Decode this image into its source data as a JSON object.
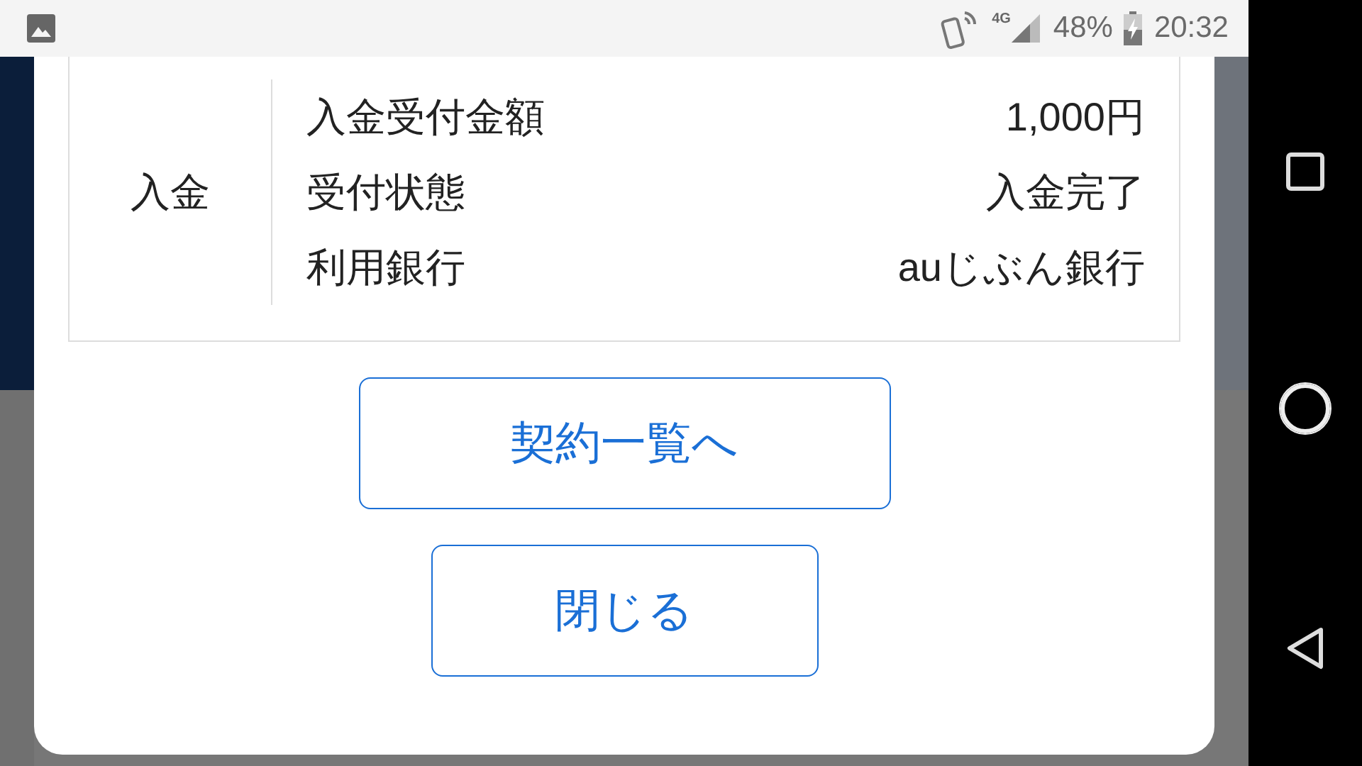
{
  "status_bar": {
    "network": "4G",
    "battery": "48%",
    "time": "20:32"
  },
  "details": {
    "section": "入金",
    "rows": [
      {
        "label": "入金受付金額",
        "value": "1,000円"
      },
      {
        "label": "受付状態",
        "value": "入金完了"
      },
      {
        "label": "利用銀行",
        "value": "auじぶん銀行"
      }
    ]
  },
  "buttons": [
    {
      "label": "契約一覧へ",
      "kind": "wide"
    },
    {
      "label": "閉じる",
      "kind": "narrow"
    }
  ]
}
